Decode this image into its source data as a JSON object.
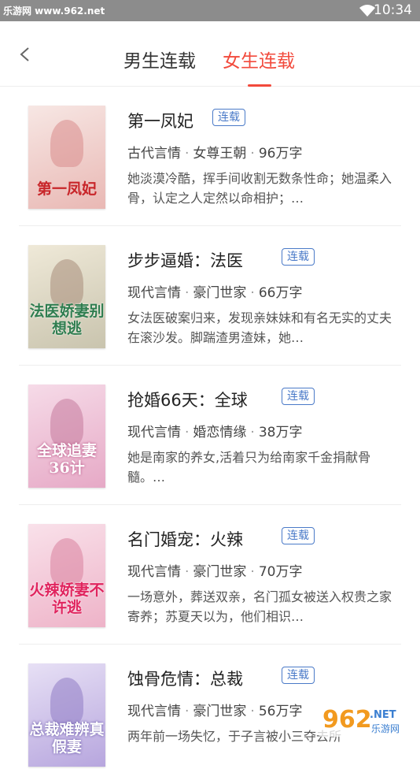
{
  "status_bar": {
    "site": "乐游网 www.962.net",
    "time": "10:34"
  },
  "header": {
    "tabs": [
      {
        "label": "男生连载"
      },
      {
        "label": "女生连载"
      }
    ]
  },
  "books": [
    {
      "title": "第一凤妃",
      "badge": "连载",
      "genre": "古代言情",
      "subgenre": "女尊王朝",
      "words": "96万字",
      "desc": "她淡漠冷酷，挥手间收割无数条性命；她温柔入骨，认定之人定然以命相护；…",
      "cover_text": "第一凤妃",
      "cover_colors": [
        "#f7e7e4",
        "#e9b8b4"
      ]
    },
    {
      "title": "步步逼婚：法医",
      "badge": "连载",
      "genre": "现代言情",
      "subgenre": "豪门世家",
      "words": "66万字",
      "desc": "女法医破案归来，发现亲妹妹和有名无实的丈夫在滚沙发。脚踹渣男渣妹，她…",
      "cover_text": "法医娇妻别想逃",
      "cover_colors": [
        "#efe9d8",
        "#c9c4ae"
      ]
    },
    {
      "title": "抢婚66天：全球",
      "badge": "连载",
      "genre": "现代言情",
      "subgenre": "婚恋情缘",
      "words": "38万字",
      "desc": "她是南家的养女,活着只为给南家千金捐献骨髓。…",
      "cover_text": "全球追妻36计",
      "cover_colors": [
        "#f6dbe8",
        "#e6a9c6"
      ]
    },
    {
      "title": "名门婚宠：火辣",
      "badge": "连载",
      "genre": "现代言情",
      "subgenre": "豪门世家",
      "words": "70万字",
      "desc": "一场意外，葬送双亲，名门孤女被送入权贵之家寄养；苏夏天以为，他们相识…",
      "cover_text": "火辣娇妻不许逃",
      "cover_colors": [
        "#f9e1ea",
        "#eeb3c8"
      ]
    },
    {
      "title": "蚀骨危情：总裁",
      "badge": "连载",
      "genre": "现代言情",
      "subgenre": "豪门世家",
      "words": "56万字",
      "desc": "两年前一场失忆，于子言被小三夺去所",
      "cover_text": "总裁难辨真假妻",
      "cover_colors": [
        "#e7e0f5",
        "#b7a6de"
      ]
    }
  ],
  "watermark": {
    "main": "962",
    "sub": "乐游网",
    "suffix": ".NET"
  },
  "colors": {
    "accent": "#f24a3c",
    "badge": "#4a7ac8",
    "status_bar": "#8c8c8c"
  }
}
